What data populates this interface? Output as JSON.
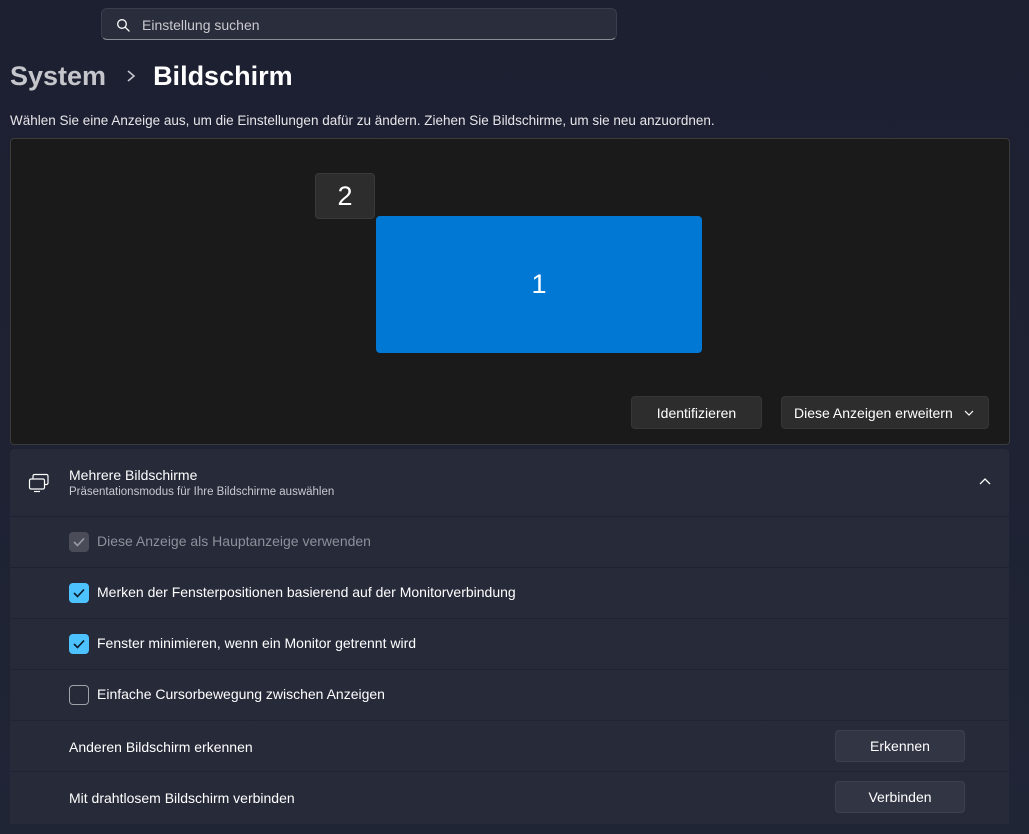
{
  "search": {
    "placeholder": "Einstellung suchen"
  },
  "breadcrumb": {
    "parent": "System",
    "current": "Bildschirm"
  },
  "description": "Wählen Sie eine Anzeige aus, um die Einstellungen dafür zu ändern. Ziehen Sie Bildschirme, um sie neu anzuordnen.",
  "arrangement": {
    "monitors": [
      {
        "label": "2",
        "selected": false
      },
      {
        "label": "1",
        "selected": true,
        "color": "#0078d4"
      }
    ],
    "identify_label": "Identifizieren",
    "mode_label": "Diese Anzeigen erweitern"
  },
  "multiple_displays": {
    "title": "Mehrere Bildschirme",
    "subtitle": "Präsentationsmodus für Ihre Bildschirme auswählen",
    "expanded": true,
    "options": [
      {
        "label": "Diese Anzeige als Hauptanzeige verwenden",
        "checked": true,
        "disabled": true
      },
      {
        "label": "Merken der Fensterpositionen basierend auf der Monitorverbindung",
        "checked": true,
        "disabled": false
      },
      {
        "label": "Fenster minimieren, wenn ein Monitor getrennt wird",
        "checked": true,
        "disabled": false
      },
      {
        "label": "Einfache Cursorbewegung zwischen Anzeigen",
        "checked": false,
        "disabled": false
      }
    ],
    "detect": {
      "label": "Anderen Bildschirm erkennen",
      "button": "Erkennen"
    },
    "wireless": {
      "label": "Mit drahtlosem Bildschirm verbinden",
      "button": "Verbinden"
    }
  },
  "colors": {
    "accent": "#4cc2ff",
    "monitor_selected": "#0078d4"
  }
}
